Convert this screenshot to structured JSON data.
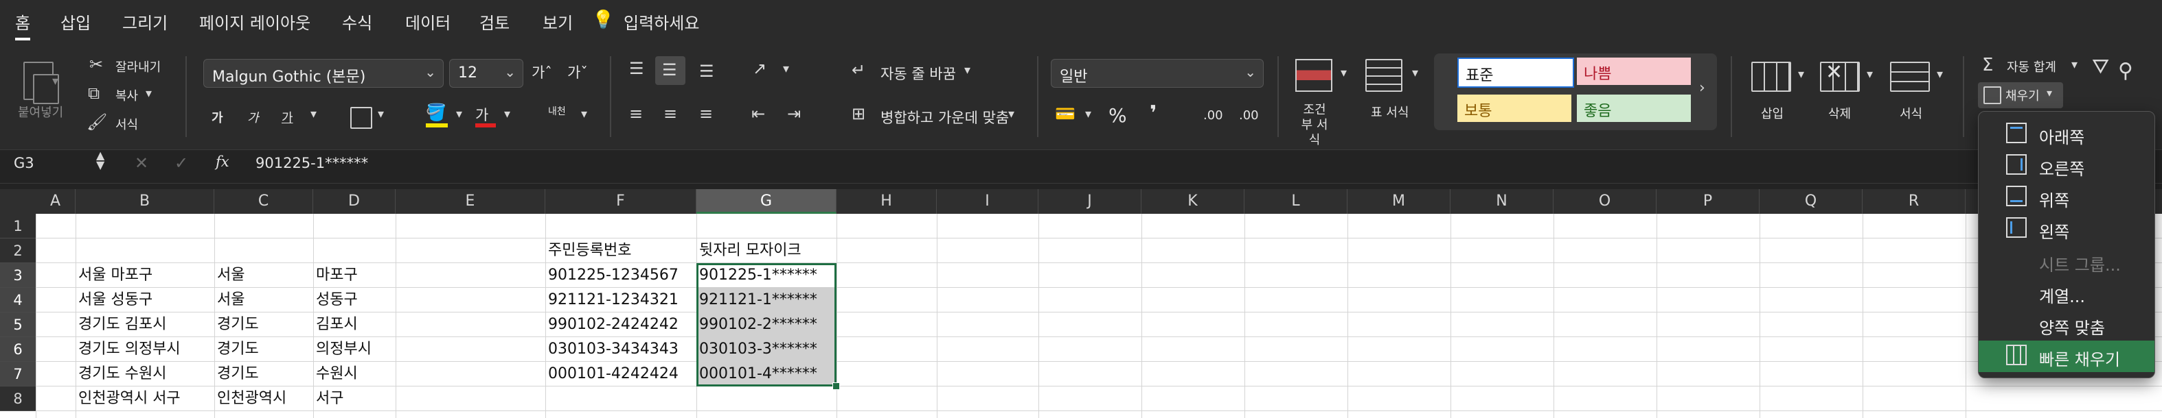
{
  "menu": {
    "tabs": [
      "홈",
      "삽입",
      "그리기",
      "페이지 레이아웃",
      "수식",
      "데이터",
      "검토",
      "보기"
    ],
    "tell_me": "입력하세요"
  },
  "clipboard": {
    "paste": "붙여넣기",
    "cut": "잘라내기",
    "copy": "복사",
    "format_painter": "서식"
  },
  "font": {
    "name": "Malgun Gothic (본문)",
    "size": "12",
    "grow": "가ˆ",
    "shrink": "가ˇ",
    "bold": "가",
    "italic": "가",
    "underline": "가",
    "font_color_glyph": "가",
    "phonetic": "내천"
  },
  "alignment": {
    "wrap_text": "자동 줄 바꿈",
    "merge_center": "병합하고 가운데 맞춤"
  },
  "number": {
    "format": "일반",
    "percent": "%",
    "comma": "❜",
    "inc_decimal": ".00",
    "dec_decimal": ".00"
  },
  "styles": {
    "conditional": "조건부 서식",
    "format_table": "표 서식",
    "normal": "표준",
    "bad": "나쁨",
    "neutral": "보통",
    "good": "좋음"
  },
  "cells": {
    "insert": "삽입",
    "delete": "삭제",
    "format": "서식"
  },
  "editing": {
    "autosum": "자동 합계",
    "fill": "채우기"
  },
  "formula_bar": {
    "name_box": "G3",
    "fx": "fx",
    "value": "901225-1******"
  },
  "columns": [
    "A",
    "B",
    "C",
    "D",
    "E",
    "F",
    "G",
    "H",
    "I",
    "J",
    "K",
    "L",
    "M",
    "N",
    "O",
    "P",
    "Q",
    "R"
  ],
  "rows": [
    "1",
    "2",
    "3",
    "4",
    "5",
    "6",
    "7",
    "8"
  ],
  "sheet": {
    "F2": "주민등록번호",
    "G2": "뒷자리 모자이크",
    "data": [
      {
        "B": "서울 마포구",
        "C": "서울",
        "D": "마포구",
        "F": "901225-1234567",
        "G": "901225-1******"
      },
      {
        "B": "서울 성동구",
        "C": "서울",
        "D": "성동구",
        "F": "921121-1234321",
        "G": "921121-1******"
      },
      {
        "B": "경기도 김포시",
        "C": "경기도",
        "D": "김포시",
        "F": "990102-2424242",
        "G": "990102-2******"
      },
      {
        "B": "경기도 의정부시",
        "C": "경기도",
        "D": "의정부시",
        "F": "030103-3434343",
        "G": "030103-3******"
      },
      {
        "B": "경기도 수원시",
        "C": "경기도",
        "D": "수원시",
        "F": "000101-4242424",
        "G": "000101-4******"
      },
      {
        "B": "인천광역시 서구",
        "C": "인천광역시",
        "D": "서구",
        "F": "",
        "G": ""
      }
    ]
  },
  "fill_menu": {
    "items": [
      "아래쪽",
      "오른쪽",
      "위쪽",
      "왼쪽",
      "시트 그룹...",
      "계열...",
      "양쪽 맞춤",
      "빠른 채우기"
    ]
  },
  "colors": {
    "selection_fill": "#d0d0d0",
    "selection_border": "#1f6e43",
    "highlight": "#2e7d4a",
    "bad_bg": "#f8c9ce",
    "neutral_bg": "#fdeaa3",
    "good_bg": "#cfe9cf"
  }
}
